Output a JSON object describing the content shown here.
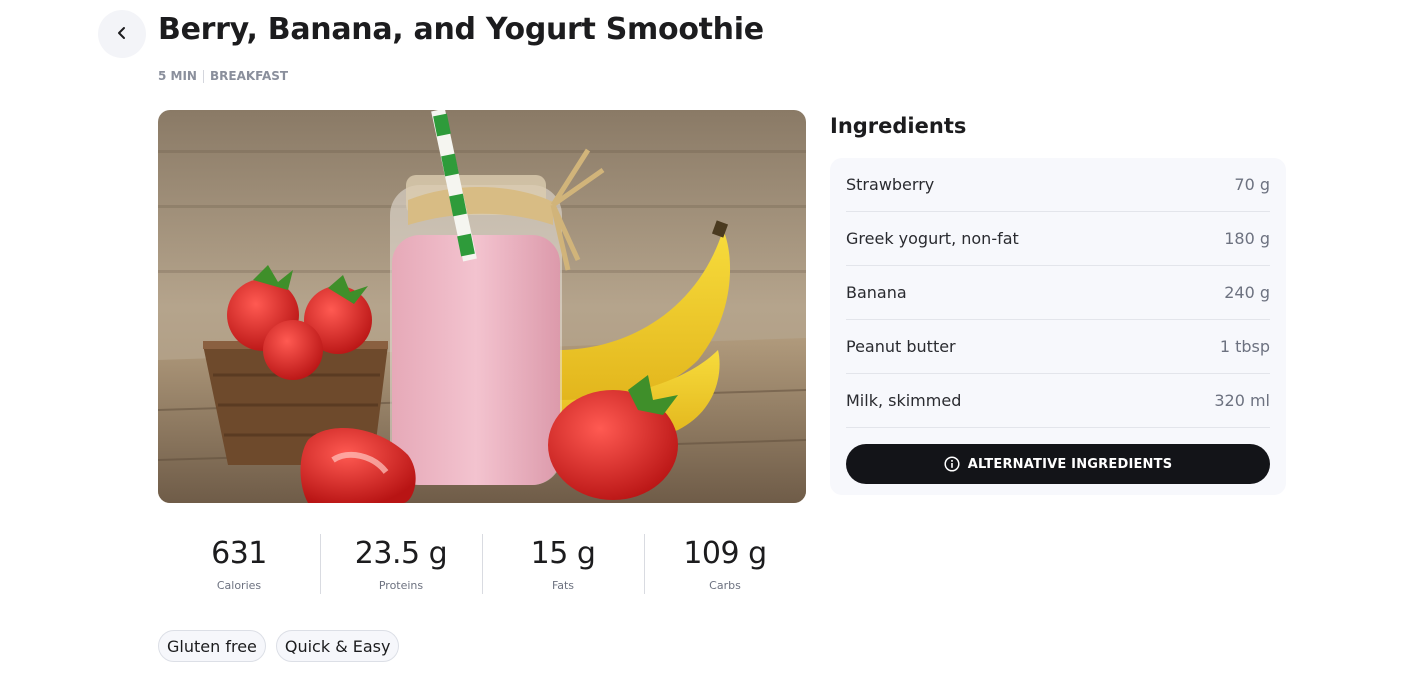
{
  "header": {
    "title": "Berry, Banana, and Yogurt Smoothie",
    "time": "5 MIN",
    "category": "BREAKFAST",
    "back_icon": "chevron-left-icon"
  },
  "nutrition": [
    {
      "value": "631",
      "label": "Calories"
    },
    {
      "value": "23.5 g",
      "label": "Proteins"
    },
    {
      "value": "15 g",
      "label": "Fats"
    },
    {
      "value": "109 g",
      "label": "Carbs"
    }
  ],
  "tags": [
    "Gluten free",
    "Quick & Easy"
  ],
  "ingredients": {
    "heading": "Ingredients",
    "items": [
      {
        "name": "Strawberry",
        "qty": "70 g"
      },
      {
        "name": "Greek yogurt, non-fat",
        "qty": "180 g"
      },
      {
        "name": "Banana",
        "qty": "240 g"
      },
      {
        "name": "Peanut butter",
        "qty": "1 tbsp"
      },
      {
        "name": "Milk, skimmed",
        "qty": "320 ml"
      }
    ],
    "alt_button": "ALTERNATIVE INGREDIENTS",
    "alt_icon": "info-icon"
  },
  "colors": {
    "accent_dark": "#131418",
    "card_bg": "#f7f8fc",
    "muted_text": "#8a8f9c"
  }
}
